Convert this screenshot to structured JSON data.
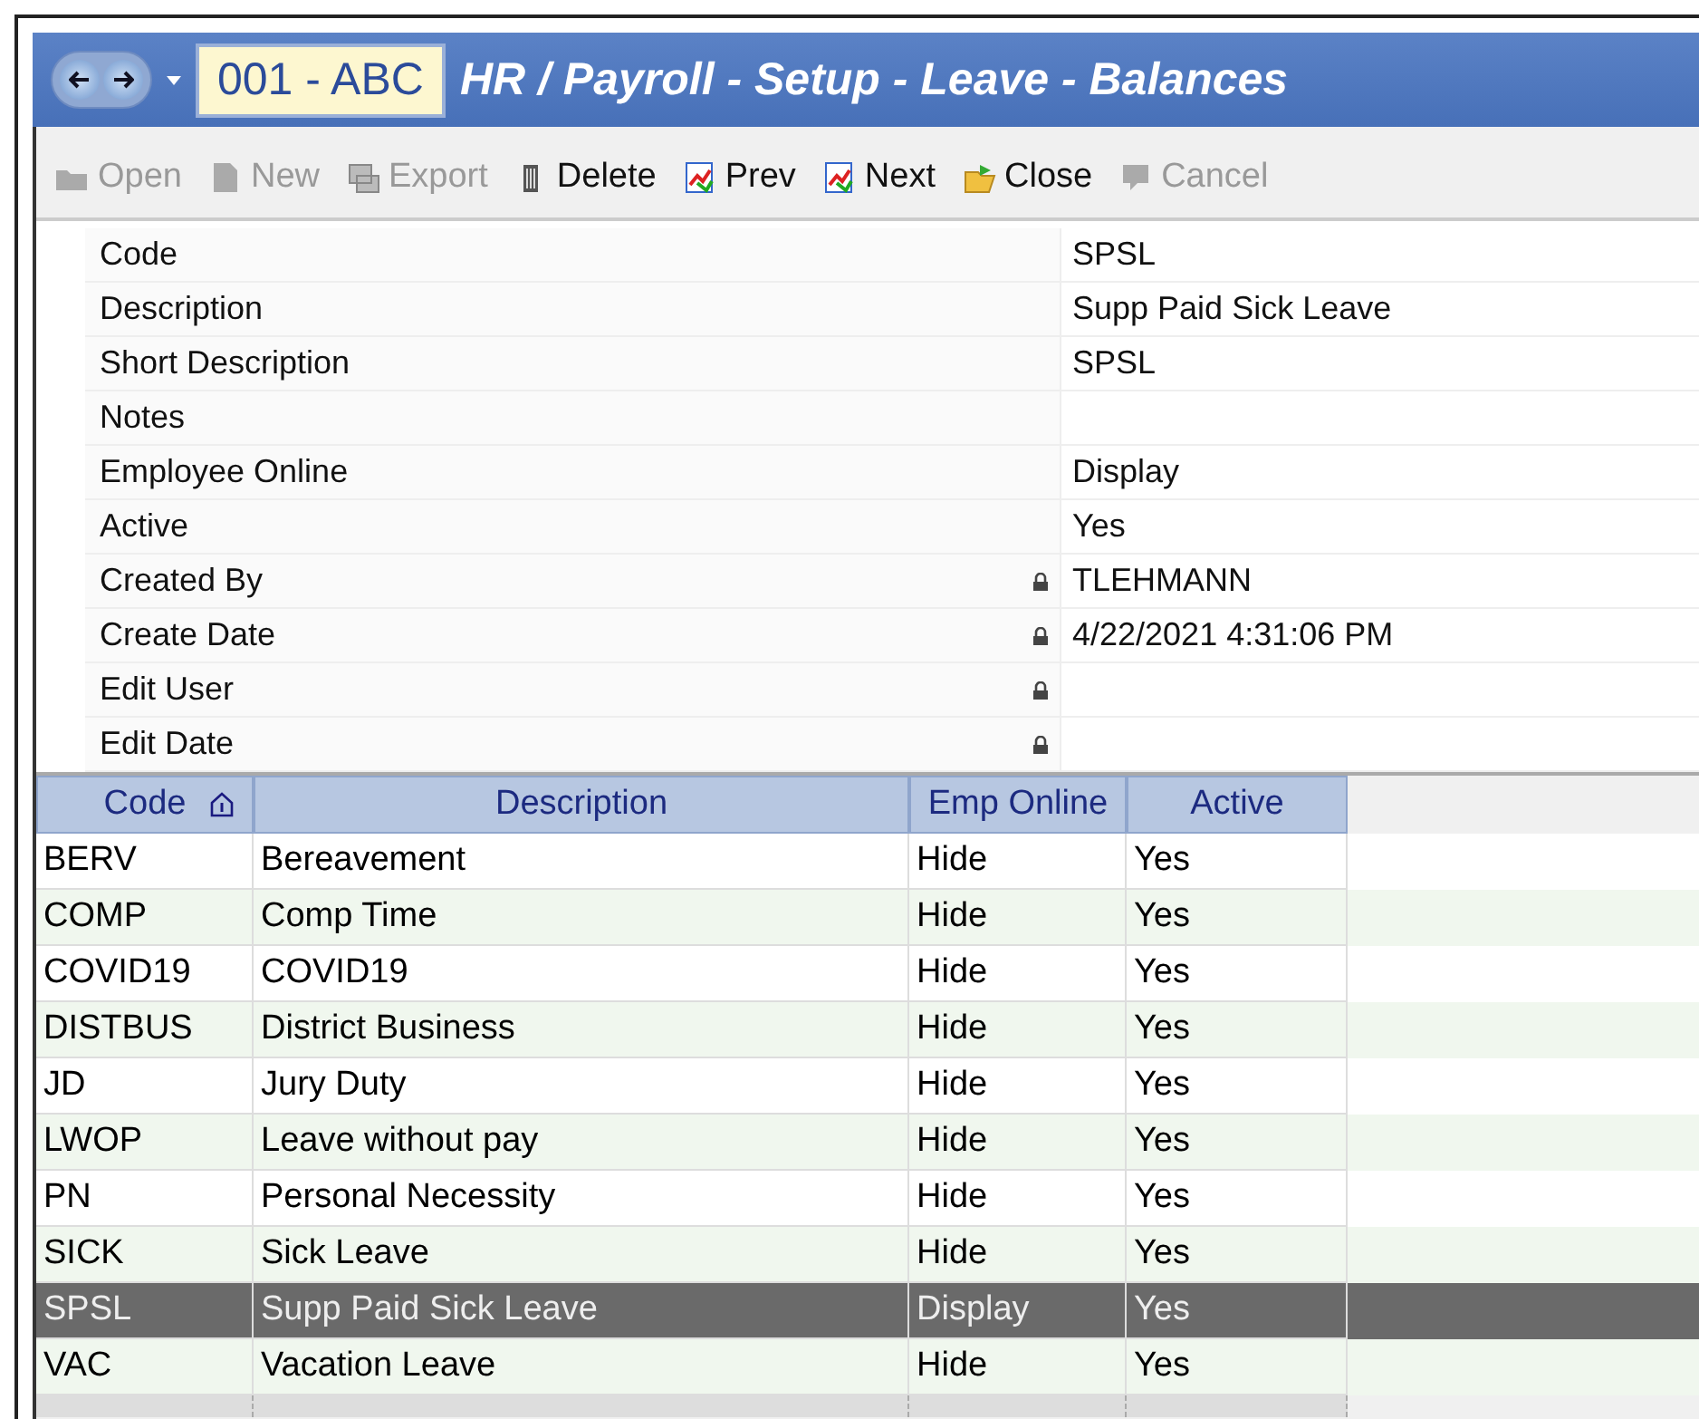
{
  "window": {
    "company": "001 - ABC",
    "title": "HR / Payroll - Setup - Leave - Balances"
  },
  "toolbar": [
    {
      "label": "Open",
      "disabled": true
    },
    {
      "label": "New",
      "disabled": true
    },
    {
      "label": "Export",
      "disabled": true
    },
    {
      "label": "Delete",
      "disabled": false
    },
    {
      "label": "Prev",
      "disabled": false
    },
    {
      "label": "Next",
      "disabled": false
    },
    {
      "label": "Close",
      "disabled": false
    },
    {
      "label": "Cancel",
      "disabled": true
    }
  ],
  "properties": [
    {
      "label": "Code",
      "value": "SPSL",
      "locked": false
    },
    {
      "label": "Description",
      "value": "Supp Paid Sick Leave",
      "locked": false
    },
    {
      "label": "Short Description",
      "value": "SPSL",
      "locked": false
    },
    {
      "label": "Notes",
      "locked": false
    },
    {
      "label": "Employee Online",
      "value": "Display",
      "locked": false
    },
    {
      "label": "Active",
      "value": "Yes",
      "locked": false
    },
    {
      "label": "Created By",
      "value": "TLEHMANN",
      "locked": true
    },
    {
      "label": "Create Date",
      "value": "4/22/2021 4:31:06 PM",
      "locked": true
    },
    {
      "label": "Edit User",
      "locked": true
    },
    {
      "label": "Edit Date",
      "locked": true
    }
  ],
  "table": {
    "columns": [
      "Code",
      "Description",
      "Emp Online",
      "Active"
    ],
    "rows": [
      {
        "cells": [
          "BERV",
          "Bereavement",
          "Hide",
          "Yes"
        ],
        "selected": false
      },
      {
        "cells": [
          "COMP",
          "Comp Time",
          "Hide",
          "Yes"
        ],
        "selected": false
      },
      {
        "cells": [
          "COVID19",
          "COVID19",
          "Hide",
          "Yes"
        ],
        "selected": false
      },
      {
        "cells": [
          "DISTBUS",
          "District Business",
          "Hide",
          "Yes"
        ],
        "selected": false
      },
      {
        "cells": [
          "JD",
          "Jury Duty",
          "Hide",
          "Yes"
        ],
        "selected": false
      },
      {
        "cells": [
          "LWOP",
          "Leave without pay",
          "Hide",
          "Yes"
        ],
        "selected": false
      },
      {
        "cells": [
          "PN",
          "Personal Necessity",
          "Hide",
          "Yes"
        ],
        "selected": false
      },
      {
        "cells": [
          "SICK",
          "Sick Leave",
          "Hide",
          "Yes"
        ],
        "selected": false
      },
      {
        "cells": [
          "SPSL",
          "Supp Paid Sick Leave",
          "Display",
          "Yes"
        ],
        "selected": true
      },
      {
        "cells": [
          "VAC",
          "Vacation Leave",
          "Hide",
          "Yes"
        ],
        "selected": false
      }
    ]
  }
}
